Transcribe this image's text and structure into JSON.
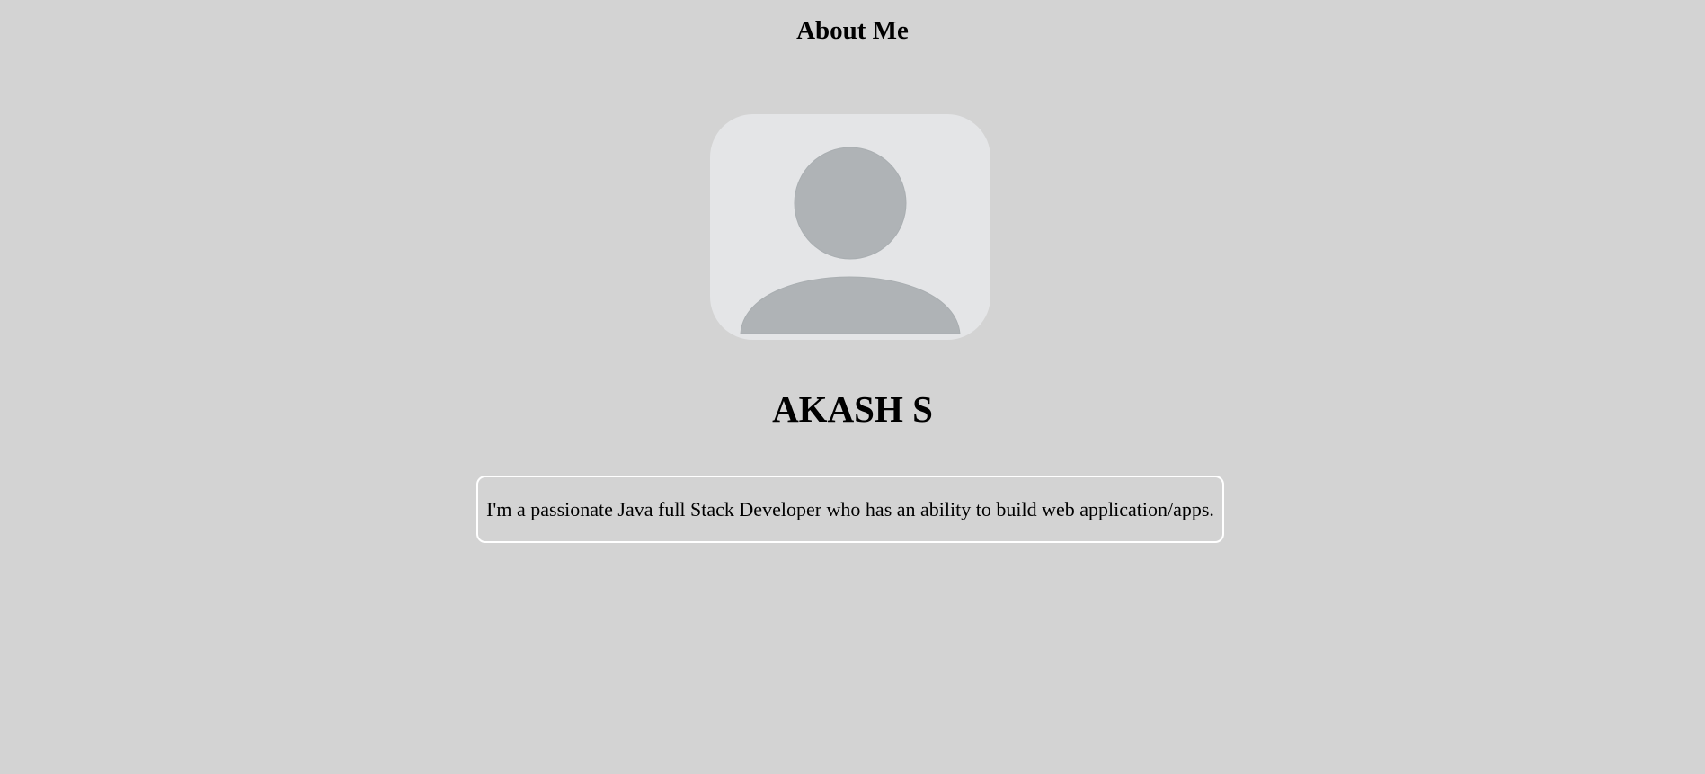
{
  "header": {
    "title": "About Me"
  },
  "profile": {
    "avatar_icon": "user-silhouette-icon",
    "name": "AKASH S",
    "bio": "I'm a passionate Java full Stack Developer who has an ability to build web application/apps."
  },
  "colors": {
    "background": "#d3d3d3",
    "avatar_background": "#e4e5e7",
    "avatar_silhouette": "#afb3b6",
    "bio_border": "#ffffff"
  }
}
